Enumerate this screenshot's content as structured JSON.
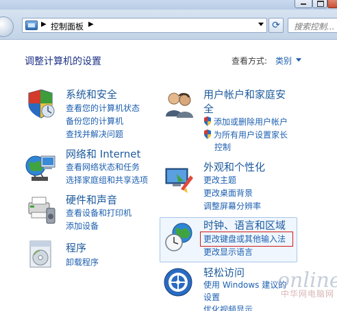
{
  "address_bar": {
    "breadcrumb": "控制面板",
    "search_placeholder": "搜索控制..."
  },
  "header": {
    "title": "调整计算机的设置",
    "view_by_label": "查看方式:",
    "view_by_value": "类别"
  },
  "categories": [
    {
      "title": "系统和安全",
      "links": [
        "查看您的计算机状态",
        "备份您的计算机",
        "查找并解决问题"
      ]
    },
    {
      "title": "网络和 Internet",
      "links": [
        "查看网络状态和任务",
        "选择家庭组和共享选项"
      ]
    },
    {
      "title": "硬件和声音",
      "links": [
        "查看设备和打印机",
        "添加设备"
      ]
    },
    {
      "title": "程序",
      "links": [
        "卸载程序"
      ]
    },
    {
      "title_line1": "用户帐户和家庭安",
      "title_line2": "全",
      "links": [
        "添加或删除用户帐户",
        "为所有用户设置家长",
        "控制"
      ]
    },
    {
      "title": "外观和个性化",
      "links": [
        "更改主题",
        "更改桌面背景",
        "调整屏幕分辨率"
      ]
    },
    {
      "title": "时钟、语言和区域",
      "links": [
        "更改键盘或其他输入法",
        "更改显示语言"
      ]
    },
    {
      "title": "轻松访问",
      "links": [
        "使用 Windows 建议的",
        "设置",
        "优化视频显示"
      ]
    }
  ],
  "watermark": {
    "logo": "online",
    "sub": "中华网电脑网"
  }
}
